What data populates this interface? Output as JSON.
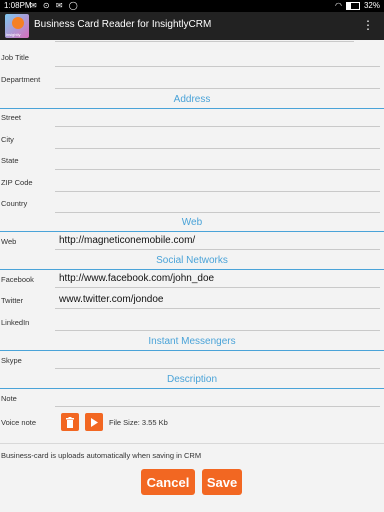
{
  "status_bar": {
    "time": "1:08PM",
    "battery": "32%"
  },
  "app": {
    "title": "Business Card Reader for InsightlyCRM",
    "icon_label": "insightly"
  },
  "fields": {
    "job_title": {
      "label": "Job Title",
      "value": ""
    },
    "department": {
      "label": "Department",
      "value": ""
    },
    "street": {
      "label": "Street",
      "value": ""
    },
    "city": {
      "label": "City",
      "value": ""
    },
    "state": {
      "label": "State",
      "value": ""
    },
    "zip": {
      "label": "ZIP Code",
      "value": ""
    },
    "country": {
      "label": "Country",
      "value": ""
    },
    "web": {
      "label": "Web",
      "value": "http://magneticonemobile.com/"
    },
    "facebook": {
      "label": "Facebook",
      "value": "http://www.facebook.com/john_doe"
    },
    "twitter": {
      "label": "Twitter",
      "value": "www.twitter.com/jondoe"
    },
    "linkedin": {
      "label": "LinkedIn",
      "value": ""
    },
    "skype": {
      "label": "Skype",
      "value": ""
    },
    "note": {
      "label": "Note",
      "value": ""
    }
  },
  "sections": {
    "address": "Address",
    "web": "Web",
    "social": "Social Networks",
    "im": "Instant Messengers",
    "description": "Description"
  },
  "voice_note": {
    "label": "Voice note",
    "file_size": "File Size: 3.55 Kb"
  },
  "footer_note": "Business-card is uploads automatically when saving in CRM",
  "buttons": {
    "cancel": "Cancel",
    "save": "Save"
  },
  "colors": {
    "accent": "#f26722",
    "section": "#4aa3d8"
  }
}
